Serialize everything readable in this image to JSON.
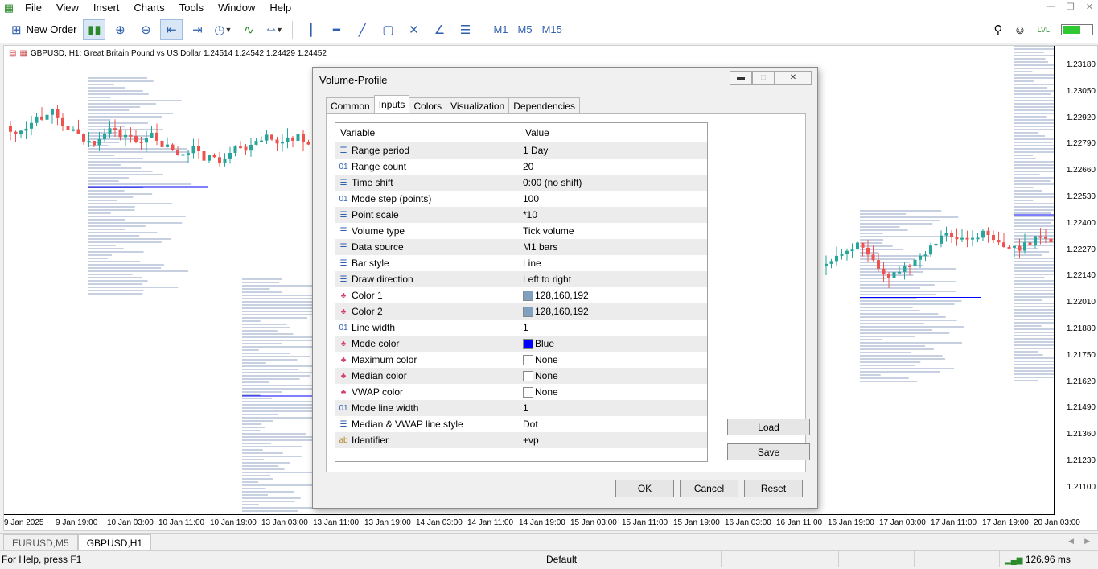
{
  "menu": {
    "items": [
      "File",
      "View",
      "Insert",
      "Charts",
      "Tools",
      "Window",
      "Help"
    ]
  },
  "toolbar": {
    "new_order_label": "New Order",
    "timeframes": [
      "M1",
      "M5",
      "M15"
    ]
  },
  "chart": {
    "symbol_info": "GBPUSD, H1:  Great Britain Pound vs US Dollar  1.24514 1.24542 1.24429 1.24452",
    "y_ticks": [
      "1.23180",
      "1.23050",
      "1.22920",
      "1.22790",
      "1.22660",
      "1.22530",
      "1.22400",
      "1.22270",
      "1.22140",
      "1.22010",
      "1.21880",
      "1.21750",
      "1.21620",
      "1.21490",
      "1.21360",
      "1.21230",
      "1.21100"
    ],
    "x_ticks": [
      "9 Jan 2025",
      "9 Jan 19:00",
      "10 Jan 03:00",
      "10 Jan 11:00",
      "10 Jan 19:00",
      "13 Jan 03:00",
      "13 Jan 11:00",
      "13 Jan 19:00",
      "14 Jan 03:00",
      "14 Jan 11:00",
      "14 Jan 19:00",
      "15 Jan 03:00",
      "15 Jan 11:00",
      "15 Jan 19:00",
      "16 Jan 03:00",
      "16 Jan 11:00",
      "16 Jan 19:00",
      "17 Jan 03:00",
      "17 Jan 11:00",
      "17 Jan 19:00",
      "20 Jan 03:00"
    ],
    "colors": {
      "bull": "#26a69a",
      "bear": "#ef5350",
      "profile": "#8ca0c0",
      "mode": "#0000ff"
    }
  },
  "dialog": {
    "title": "Volume-Profile",
    "tabs": [
      "Common",
      "Inputs",
      "Colors",
      "Visualization",
      "Dependencies"
    ],
    "active_tab": "Inputs",
    "grid_header": {
      "variable": "Variable",
      "value": "Value"
    },
    "rows": [
      {
        "icon": "enum-icon",
        "name": "Range period",
        "value": "1 Day"
      },
      {
        "icon": "int-icon",
        "name": "Range count",
        "value": "20"
      },
      {
        "icon": "enum-icon",
        "name": "Time shift",
        "value": "0:00 (no shift)"
      },
      {
        "icon": "int-icon",
        "name": "Mode step (points)",
        "value": "100"
      },
      {
        "icon": "enum-icon",
        "name": "Point scale",
        "value": "*10"
      },
      {
        "icon": "enum-icon",
        "name": "Volume type",
        "value": "Tick volume"
      },
      {
        "icon": "enum-icon",
        "name": "Data source",
        "value": "M1 bars"
      },
      {
        "icon": "enum-icon",
        "name": "Bar style",
        "value": "Line"
      },
      {
        "icon": "enum-icon",
        "name": "Draw direction",
        "value": "Left to right"
      },
      {
        "icon": "color-icon",
        "name": "Color 1",
        "value": "128,160,192",
        "swatch": "#80a0c0"
      },
      {
        "icon": "color-icon",
        "name": "Color 2",
        "value": "128,160,192",
        "swatch": "#80a0c0"
      },
      {
        "icon": "int-icon",
        "name": "Line width",
        "value": "1"
      },
      {
        "icon": "color-icon",
        "name": "Mode color",
        "value": "Blue",
        "swatch": "#0000ff"
      },
      {
        "icon": "color-icon",
        "name": "Maximum color",
        "value": "None",
        "swatch": "#ffffff"
      },
      {
        "icon": "color-icon",
        "name": "Median color",
        "value": "None",
        "swatch": "#ffffff"
      },
      {
        "icon": "color-icon",
        "name": "VWAP color",
        "value": "None",
        "swatch": "#ffffff"
      },
      {
        "icon": "int-icon",
        "name": "Mode line width",
        "value": "1"
      },
      {
        "icon": "enum-icon",
        "name": "Median & VWAP line style",
        "value": "Dot"
      },
      {
        "icon": "string-icon",
        "name": "Identifier",
        "value": "+vp"
      }
    ],
    "load_label": "Load",
    "save_label": "Save",
    "ok_label": "OK",
    "cancel_label": "Cancel",
    "reset_label": "Reset"
  },
  "chart_tabs": [
    "EURUSD,M5",
    "GBPUSD,H1"
  ],
  "status": {
    "help": "For Help, press F1",
    "profile": "Default",
    "ping": "126.96 ms"
  }
}
